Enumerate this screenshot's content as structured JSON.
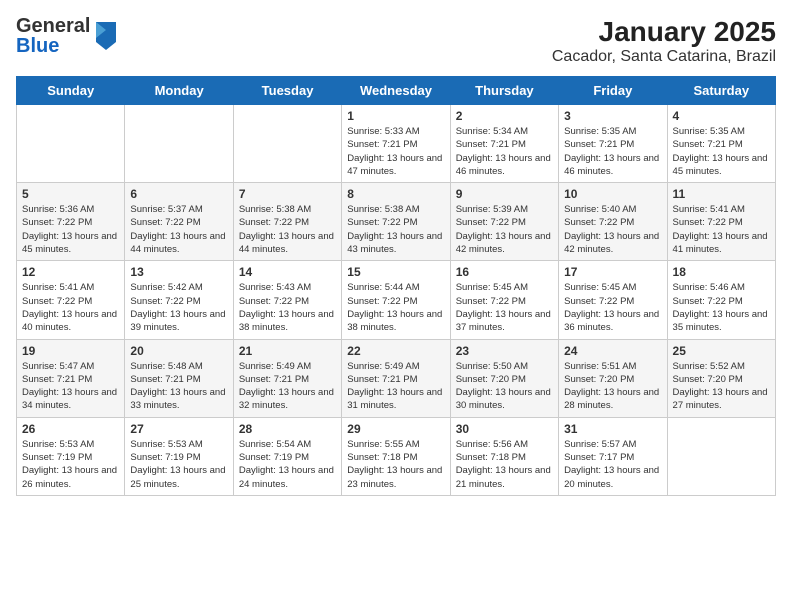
{
  "header": {
    "logo_general": "General",
    "logo_blue": "Blue",
    "title": "January 2025",
    "subtitle": "Cacador, Santa Catarina, Brazil"
  },
  "days_of_week": [
    "Sunday",
    "Monday",
    "Tuesday",
    "Wednesday",
    "Thursday",
    "Friday",
    "Saturday"
  ],
  "weeks": [
    [
      {
        "day": "",
        "content": ""
      },
      {
        "day": "",
        "content": ""
      },
      {
        "day": "",
        "content": ""
      },
      {
        "day": "1",
        "content": "Sunrise: 5:33 AM\nSunset: 7:21 PM\nDaylight: 13 hours and 47 minutes."
      },
      {
        "day": "2",
        "content": "Sunrise: 5:34 AM\nSunset: 7:21 PM\nDaylight: 13 hours and 46 minutes."
      },
      {
        "day": "3",
        "content": "Sunrise: 5:35 AM\nSunset: 7:21 PM\nDaylight: 13 hours and 46 minutes."
      },
      {
        "day": "4",
        "content": "Sunrise: 5:35 AM\nSunset: 7:21 PM\nDaylight: 13 hours and 45 minutes."
      }
    ],
    [
      {
        "day": "5",
        "content": "Sunrise: 5:36 AM\nSunset: 7:22 PM\nDaylight: 13 hours and 45 minutes."
      },
      {
        "day": "6",
        "content": "Sunrise: 5:37 AM\nSunset: 7:22 PM\nDaylight: 13 hours and 44 minutes."
      },
      {
        "day": "7",
        "content": "Sunrise: 5:38 AM\nSunset: 7:22 PM\nDaylight: 13 hours and 44 minutes."
      },
      {
        "day": "8",
        "content": "Sunrise: 5:38 AM\nSunset: 7:22 PM\nDaylight: 13 hours and 43 minutes."
      },
      {
        "day": "9",
        "content": "Sunrise: 5:39 AM\nSunset: 7:22 PM\nDaylight: 13 hours and 42 minutes."
      },
      {
        "day": "10",
        "content": "Sunrise: 5:40 AM\nSunset: 7:22 PM\nDaylight: 13 hours and 42 minutes."
      },
      {
        "day": "11",
        "content": "Sunrise: 5:41 AM\nSunset: 7:22 PM\nDaylight: 13 hours and 41 minutes."
      }
    ],
    [
      {
        "day": "12",
        "content": "Sunrise: 5:41 AM\nSunset: 7:22 PM\nDaylight: 13 hours and 40 minutes."
      },
      {
        "day": "13",
        "content": "Sunrise: 5:42 AM\nSunset: 7:22 PM\nDaylight: 13 hours and 39 minutes."
      },
      {
        "day": "14",
        "content": "Sunrise: 5:43 AM\nSunset: 7:22 PM\nDaylight: 13 hours and 38 minutes."
      },
      {
        "day": "15",
        "content": "Sunrise: 5:44 AM\nSunset: 7:22 PM\nDaylight: 13 hours and 38 minutes."
      },
      {
        "day": "16",
        "content": "Sunrise: 5:45 AM\nSunset: 7:22 PM\nDaylight: 13 hours and 37 minutes."
      },
      {
        "day": "17",
        "content": "Sunrise: 5:45 AM\nSunset: 7:22 PM\nDaylight: 13 hours and 36 minutes."
      },
      {
        "day": "18",
        "content": "Sunrise: 5:46 AM\nSunset: 7:22 PM\nDaylight: 13 hours and 35 minutes."
      }
    ],
    [
      {
        "day": "19",
        "content": "Sunrise: 5:47 AM\nSunset: 7:21 PM\nDaylight: 13 hours and 34 minutes."
      },
      {
        "day": "20",
        "content": "Sunrise: 5:48 AM\nSunset: 7:21 PM\nDaylight: 13 hours and 33 minutes."
      },
      {
        "day": "21",
        "content": "Sunrise: 5:49 AM\nSunset: 7:21 PM\nDaylight: 13 hours and 32 minutes."
      },
      {
        "day": "22",
        "content": "Sunrise: 5:49 AM\nSunset: 7:21 PM\nDaylight: 13 hours and 31 minutes."
      },
      {
        "day": "23",
        "content": "Sunrise: 5:50 AM\nSunset: 7:20 PM\nDaylight: 13 hours and 30 minutes."
      },
      {
        "day": "24",
        "content": "Sunrise: 5:51 AM\nSunset: 7:20 PM\nDaylight: 13 hours and 28 minutes."
      },
      {
        "day": "25",
        "content": "Sunrise: 5:52 AM\nSunset: 7:20 PM\nDaylight: 13 hours and 27 minutes."
      }
    ],
    [
      {
        "day": "26",
        "content": "Sunrise: 5:53 AM\nSunset: 7:19 PM\nDaylight: 13 hours and 26 minutes."
      },
      {
        "day": "27",
        "content": "Sunrise: 5:53 AM\nSunset: 7:19 PM\nDaylight: 13 hours and 25 minutes."
      },
      {
        "day": "28",
        "content": "Sunrise: 5:54 AM\nSunset: 7:19 PM\nDaylight: 13 hours and 24 minutes."
      },
      {
        "day": "29",
        "content": "Sunrise: 5:55 AM\nSunset: 7:18 PM\nDaylight: 13 hours and 23 minutes."
      },
      {
        "day": "30",
        "content": "Sunrise: 5:56 AM\nSunset: 7:18 PM\nDaylight: 13 hours and 21 minutes."
      },
      {
        "day": "31",
        "content": "Sunrise: 5:57 AM\nSunset: 7:17 PM\nDaylight: 13 hours and 20 minutes."
      },
      {
        "day": "",
        "content": ""
      }
    ]
  ]
}
